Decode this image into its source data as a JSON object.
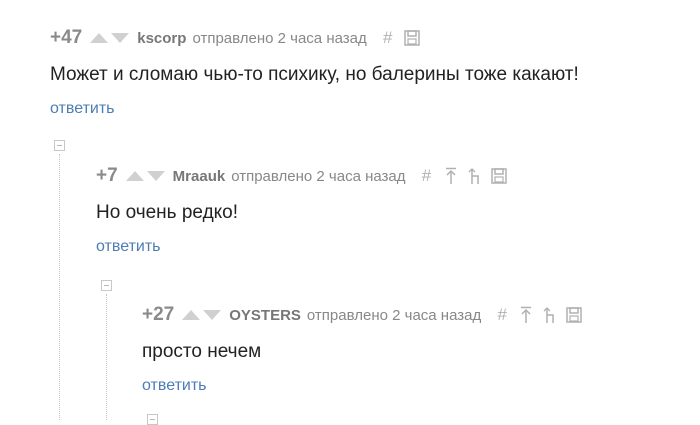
{
  "comments": [
    {
      "rating": "+47",
      "author": "kscorp",
      "meta": "отправлено 2 часа назад",
      "text": "Может и сломаю чью-то психику, но балерины тоже какают!",
      "reply": "ответить",
      "tools": [
        "hash-icon",
        "save-icon"
      ]
    },
    {
      "rating": "+7",
      "author": "Mraauk",
      "meta": "отправлено 2 часа назад",
      "text": "Но очень редко!",
      "reply": "ответить",
      "tools": [
        "hash-icon",
        "to-top-icon",
        "parent-icon",
        "save-icon"
      ]
    },
    {
      "rating": "+27",
      "author": "OYSTERS",
      "meta": "отправлено 2 часа назад",
      "text": "просто нечем",
      "reply": "ответить",
      "tools": [
        "hash-icon",
        "to-top-icon",
        "parent-icon",
        "save-icon"
      ]
    }
  ],
  "colors": {
    "link": "#4c7db3",
    "muted": "#888888",
    "vote_arrow": "#d0d0d0"
  }
}
